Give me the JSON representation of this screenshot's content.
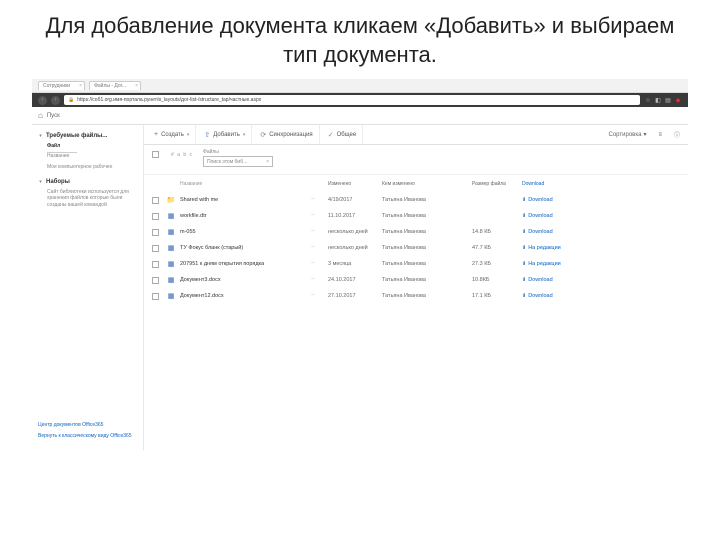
{
  "slide_title": "Для добавление документа кликаем «Добавить» и выбираем тип документа.",
  "browser": {
    "tab1_label": "Сотрудники",
    "tab2_label": "Файлы - Дог...",
    "url_text": "https://соб1.org.имя-портала.рунет/в_layouts/дог-list-/structure_tap/частные.aspx"
  },
  "appbar": {
    "home": "Пуск"
  },
  "sidebar": {
    "item1": "Требуемые файлы...",
    "item1_sub": "Файл",
    "item2": "Название",
    "item3": "Мое компьютерное рабочее",
    "item4": "Наборы",
    "item4_sub": "Сайт библиотеки используется для хранения файлов которые были созданы вашей командой"
  },
  "side_links": {
    "link1": "Центр документов Office365",
    "link2": "Вернуть к классическому виду Office365"
  },
  "toolbar": {
    "new": "Создать",
    "add": "Добавить",
    "sync": "Синхронизация",
    "more": "Общее",
    "sort": "Сортировка",
    "view_i": "≡",
    "info_i": "ⓘ"
  },
  "filter": {
    "label": "Файлы",
    "placeholder": "Поиск этом биб...",
    "alpha": "#  a  b  c"
  },
  "columns": {
    "name": "Название",
    "date": "Изменено",
    "by": "Кем изменено",
    "size": "Размер файла",
    "dl": "Download"
  },
  "rows": [
    {
      "icon": "folder",
      "name": "Shared with me",
      "date": "4/19/2017",
      "by": "Татьяна Иванова",
      "size": "",
      "dl": "Download"
    },
    {
      "icon": "docx",
      "name": "workfile.dtr",
      "date": "11.10.2017",
      "by": "Татьяна Иванова",
      "size": "",
      "dl": "Download"
    },
    {
      "icon": "doc",
      "name": "m-055",
      "date": "несколько дней",
      "by": "Татьяна Иванова",
      "size": "14.8 КБ",
      "dl": "Download"
    },
    {
      "icon": "doc",
      "name": "ТУ Фокус бланк (старый)",
      "date": "несколько дней",
      "by": "Татьяна Иванова",
      "size": "47.7 КБ",
      "dl": "На редакции"
    },
    {
      "icon": "doc",
      "name": "207951 к дням открытия порядка",
      "date": "3 месяца",
      "by": "Татьяна Иванова",
      "size": "27.3 КБ",
      "dl": "На редакции"
    },
    {
      "icon": "doc",
      "name": "Документ3.docx",
      "date": "24.10.2017",
      "by": "Татьяна Иванова",
      "size": "10.8КБ",
      "dl": "Download"
    },
    {
      "icon": "doc",
      "name": "Документ12.docx",
      "date": "27.10.2017",
      "by": "Татьяна Иванова",
      "size": "17.1 КБ",
      "dl": "Download"
    }
  ]
}
